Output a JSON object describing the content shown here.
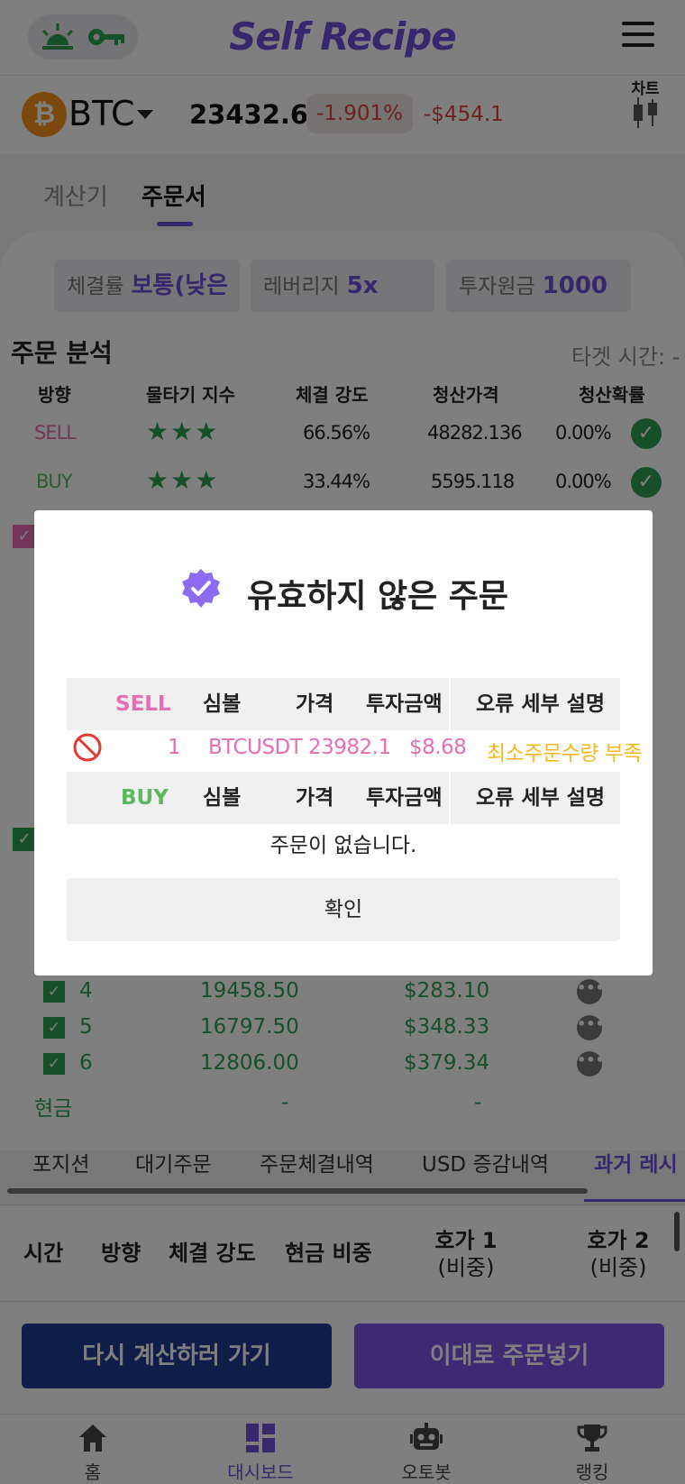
{
  "header": {
    "logo": "Self Recipe",
    "icons": [
      "sunrise-icon",
      "key-icon",
      "menu-icon"
    ]
  },
  "ticker": {
    "coin_glyph": "₿",
    "symbol": "BTC",
    "price": "23432.60",
    "change_pct": "-1.901%",
    "change_abs": "-$454.1",
    "chart_label": "차트"
  },
  "tabs": {
    "calculator": "계산기",
    "order_sheet": "주문서"
  },
  "chips": [
    {
      "label": "체결률",
      "value": "보통(낮은"
    },
    {
      "label": "레버리지",
      "value": "5x"
    },
    {
      "label": "투자원금",
      "value": "1000"
    }
  ],
  "analysis": {
    "title": "주문 분석",
    "target_time": "타겟 시간: -",
    "headers": [
      "방향",
      "물타기 지수",
      "체결 강도",
      "청산가격",
      "청산확률"
    ],
    "rows": [
      {
        "direction": "SELL",
        "stars": "★★★",
        "strength": "66.56%",
        "liq_price": "48282.136",
        "liq_prob": "0.00%"
      },
      {
        "direction": "BUY",
        "stars": "★★★",
        "strength": "33.44%",
        "liq_price": "5595.118",
        "liq_prob": "0.00%"
      }
    ]
  },
  "orders_list": [
    {
      "num": "4",
      "price": "19458.50",
      "amount": "$283.10"
    },
    {
      "num": "5",
      "price": "16797.50",
      "amount": "$348.33"
    },
    {
      "num": "6",
      "price": "12806.00",
      "amount": "$379.34"
    }
  ],
  "cash": {
    "label": "현금",
    "price": "-",
    "amount": "-"
  },
  "bottom_tabs": [
    "포지션",
    "대기주문",
    "주문체결내역",
    "USD 증감내역",
    "과거 레시"
  ],
  "history_table": {
    "headers": [
      "시간",
      "방향",
      "체결 강도",
      "현금 비중"
    ],
    "ask1": {
      "title": "호가 1",
      "sub": "(비중)"
    },
    "ask2": {
      "title": "호가 2",
      "sub": "(비중)"
    }
  },
  "actions": {
    "recalculate": "다시 계산하러 가기",
    "place_order": "이대로 주문넣기"
  },
  "nav": [
    {
      "label": "홈",
      "icon": "home-icon"
    },
    {
      "label": "대시보드",
      "icon": "dashboard-icon"
    },
    {
      "label": "오토봇",
      "icon": "robot-icon"
    },
    {
      "label": "랭킹",
      "icon": "trophy-icon"
    }
  ],
  "modal": {
    "title": "유효하지 않은 주문",
    "sell_header": {
      "side": "SELL",
      "symbol": "심볼",
      "price": "가격",
      "amount": "투자금액",
      "error": "오류 세부 설명"
    },
    "sell_row": {
      "index": "1",
      "symbol": "BTCUSDT",
      "price": "23982.1",
      "amount": "$8.68",
      "error": "최소주문수량 부족"
    },
    "buy_header": {
      "side": "BUY",
      "symbol": "심볼",
      "price": "가격",
      "amount": "투자금액",
      "error": "오류 세부 설명"
    },
    "empty_message": "주문이 없습니다.",
    "confirm": "확인"
  },
  "colors": {
    "accent": "#6f4fd8",
    "sell": "#e56fb1",
    "buy": "#5cb85c",
    "negative": "#e04040",
    "warning": "#f5b820",
    "positive_green": "#2e9e52"
  }
}
